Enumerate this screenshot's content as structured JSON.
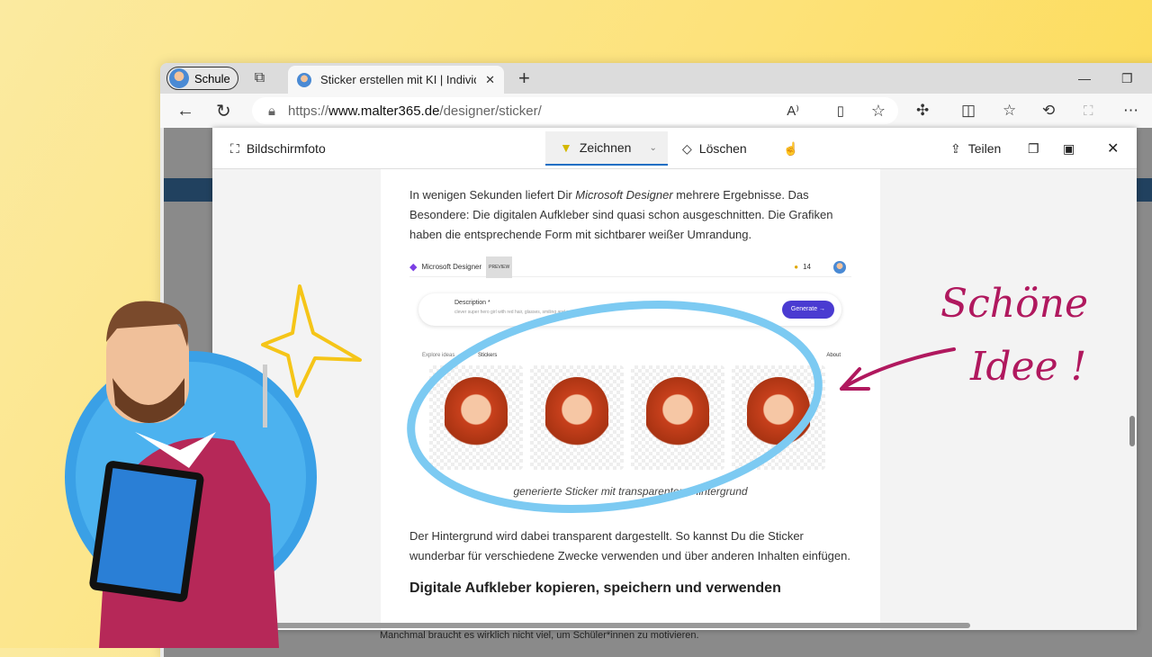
{
  "browser": {
    "profile": "Schule",
    "tab_title": "Sticker erstellen mit KI | Individuell",
    "url_scheme": "https://",
    "url_host": "www.malter365.de",
    "url_path": "/designer/sticker/"
  },
  "capture_toolbar": {
    "screenshot": "Bildschirmfoto",
    "draw": "Zeichnen",
    "erase": "Löschen",
    "share": "Teilen"
  },
  "article": {
    "p1_a": "In wenigen Sekunden liefert Dir ",
    "p1_em": "Microsoft Designer",
    "p1_b": " mehrere Ergebnisse. Das Besondere: Die digitalen Aufkleber sind quasi schon ausgeschnitten. Die Grafiken haben die entsprechende Form mit sichtbarer weißer Umrandung.",
    "designer": {
      "app": "Microsoft Designer",
      "badge": "PREVIEW",
      "coins": "14",
      "desc_label": "Description *",
      "desc_value": "clever super hero girl with red hair, glasses, smiling and reading a book",
      "generate": "Generate →",
      "tab1": "Explore ideas",
      "tab2": "Stickers",
      "about": "About"
    },
    "caption": "generierte Sticker mit transparentem Hintergrund",
    "p2": "Der Hintergrund wird dabei transparent dargestellt. So kannst Du die Sticker wunderbar für verschiedene Zwecke verwenden und über anderen Inhalten einfügen.",
    "h3": "Digitale Aufkleber kopieren, speichern und verwenden",
    "below": "Manchmal braucht es wirklich nicht viel, um Schüler*innen zu motivieren."
  },
  "annotation": {
    "line1": "Schöne",
    "line2": "Idee !"
  },
  "colors": {
    "ink_blue": "#7ccaf2",
    "ink_magenta": "#b0185e",
    "star": "#f5c518"
  }
}
